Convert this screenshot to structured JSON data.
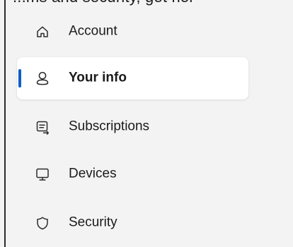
{
  "cut_text": "...ms and security, get hol",
  "sidebar": {
    "items": [
      {
        "label": "Account",
        "icon": "home-icon",
        "active": false
      },
      {
        "label": "Your info",
        "icon": "person-icon",
        "active": true
      },
      {
        "label": "Subscriptions",
        "icon": "subscriptions-icon",
        "active": false
      },
      {
        "label": "Devices",
        "icon": "monitor-icon",
        "active": false
      },
      {
        "label": "Security",
        "icon": "shield-icon",
        "active": false
      }
    ]
  },
  "colors": {
    "background": "#f3f3f3",
    "active_item_background": "#ffffff",
    "accent": "#0f5ec9",
    "text": "#1b1b1b",
    "icon": "#2b2b2b"
  }
}
